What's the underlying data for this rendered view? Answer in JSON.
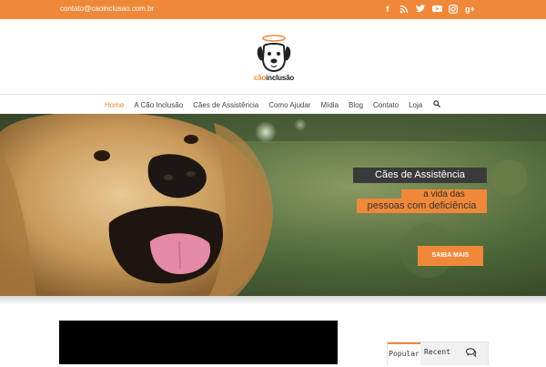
{
  "topbar": {
    "email": "contato@caoinclusao.com.br",
    "social_icons": [
      "facebook-icon",
      "rss-icon",
      "twitter-icon",
      "youtube-icon",
      "instagram-icon",
      "google-plus-icon"
    ],
    "social_glyphs": [
      "f",
      "◉",
      "t",
      "▶",
      "◘",
      "g+"
    ]
  },
  "logo": {
    "text_accent": "cão",
    "text_rest": "inclusão"
  },
  "nav": {
    "items": [
      "Home",
      "A Cão Inclusão",
      "Cães de Assistência",
      "Como Ajudar",
      "Mídia",
      "Blog",
      "Contato",
      "Loja"
    ]
  },
  "hero": {
    "caption_title": "Cães de Assistência",
    "caption_line1": "a vida das",
    "caption_line2": "pessoas com deficiência",
    "cta": "SAIBA MAIS"
  },
  "sidebar": {
    "tabs": [
      "Popular",
      "Recent"
    ],
    "tab_icon": "comments-icon"
  },
  "colors": {
    "accent": "#f0883a",
    "dark": "#3a3a3a"
  }
}
